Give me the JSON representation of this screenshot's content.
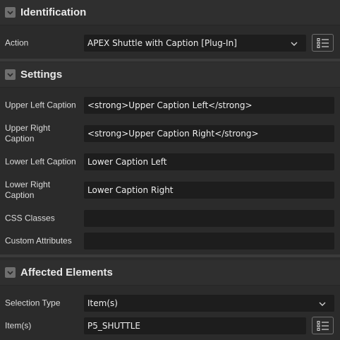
{
  "sections": {
    "identification": {
      "title": "Identification",
      "action": {
        "label": "Action",
        "value": "APEX Shuttle with Caption [Plug-In]"
      }
    },
    "settings": {
      "title": "Settings",
      "upper_left_caption": {
        "label": "Upper Left Caption",
        "value": "<strong>Upper Caption Left</strong>"
      },
      "upper_right_caption": {
        "label": "Upper Right Caption",
        "value": "<strong>Upper Caption Right</strong>"
      },
      "lower_left_caption": {
        "label": "Lower Left Caption",
        "value": "Lower Caption Left"
      },
      "lower_right_caption": {
        "label": "Lower Right Caption",
        "value": "Lower Caption Right"
      },
      "css_classes": {
        "label": "CSS Classes",
        "value": ""
      },
      "custom_attributes": {
        "label": "Custom Attributes",
        "value": ""
      }
    },
    "affected_elements": {
      "title": "Affected Elements",
      "selection_type": {
        "label": "Selection Type",
        "value": "Item(s)"
      },
      "items": {
        "label": "Item(s)",
        "value": "P5_SHUTTLE"
      }
    }
  },
  "icons": {
    "section_toggle": "chevron-down-icon",
    "select_arrow": "chevron-down-icon",
    "list_picker": "list-icon"
  },
  "colors": {
    "background": "#2b2b2b",
    "field_background": "#1d1d1d",
    "toggle": "#6f6f6f"
  }
}
